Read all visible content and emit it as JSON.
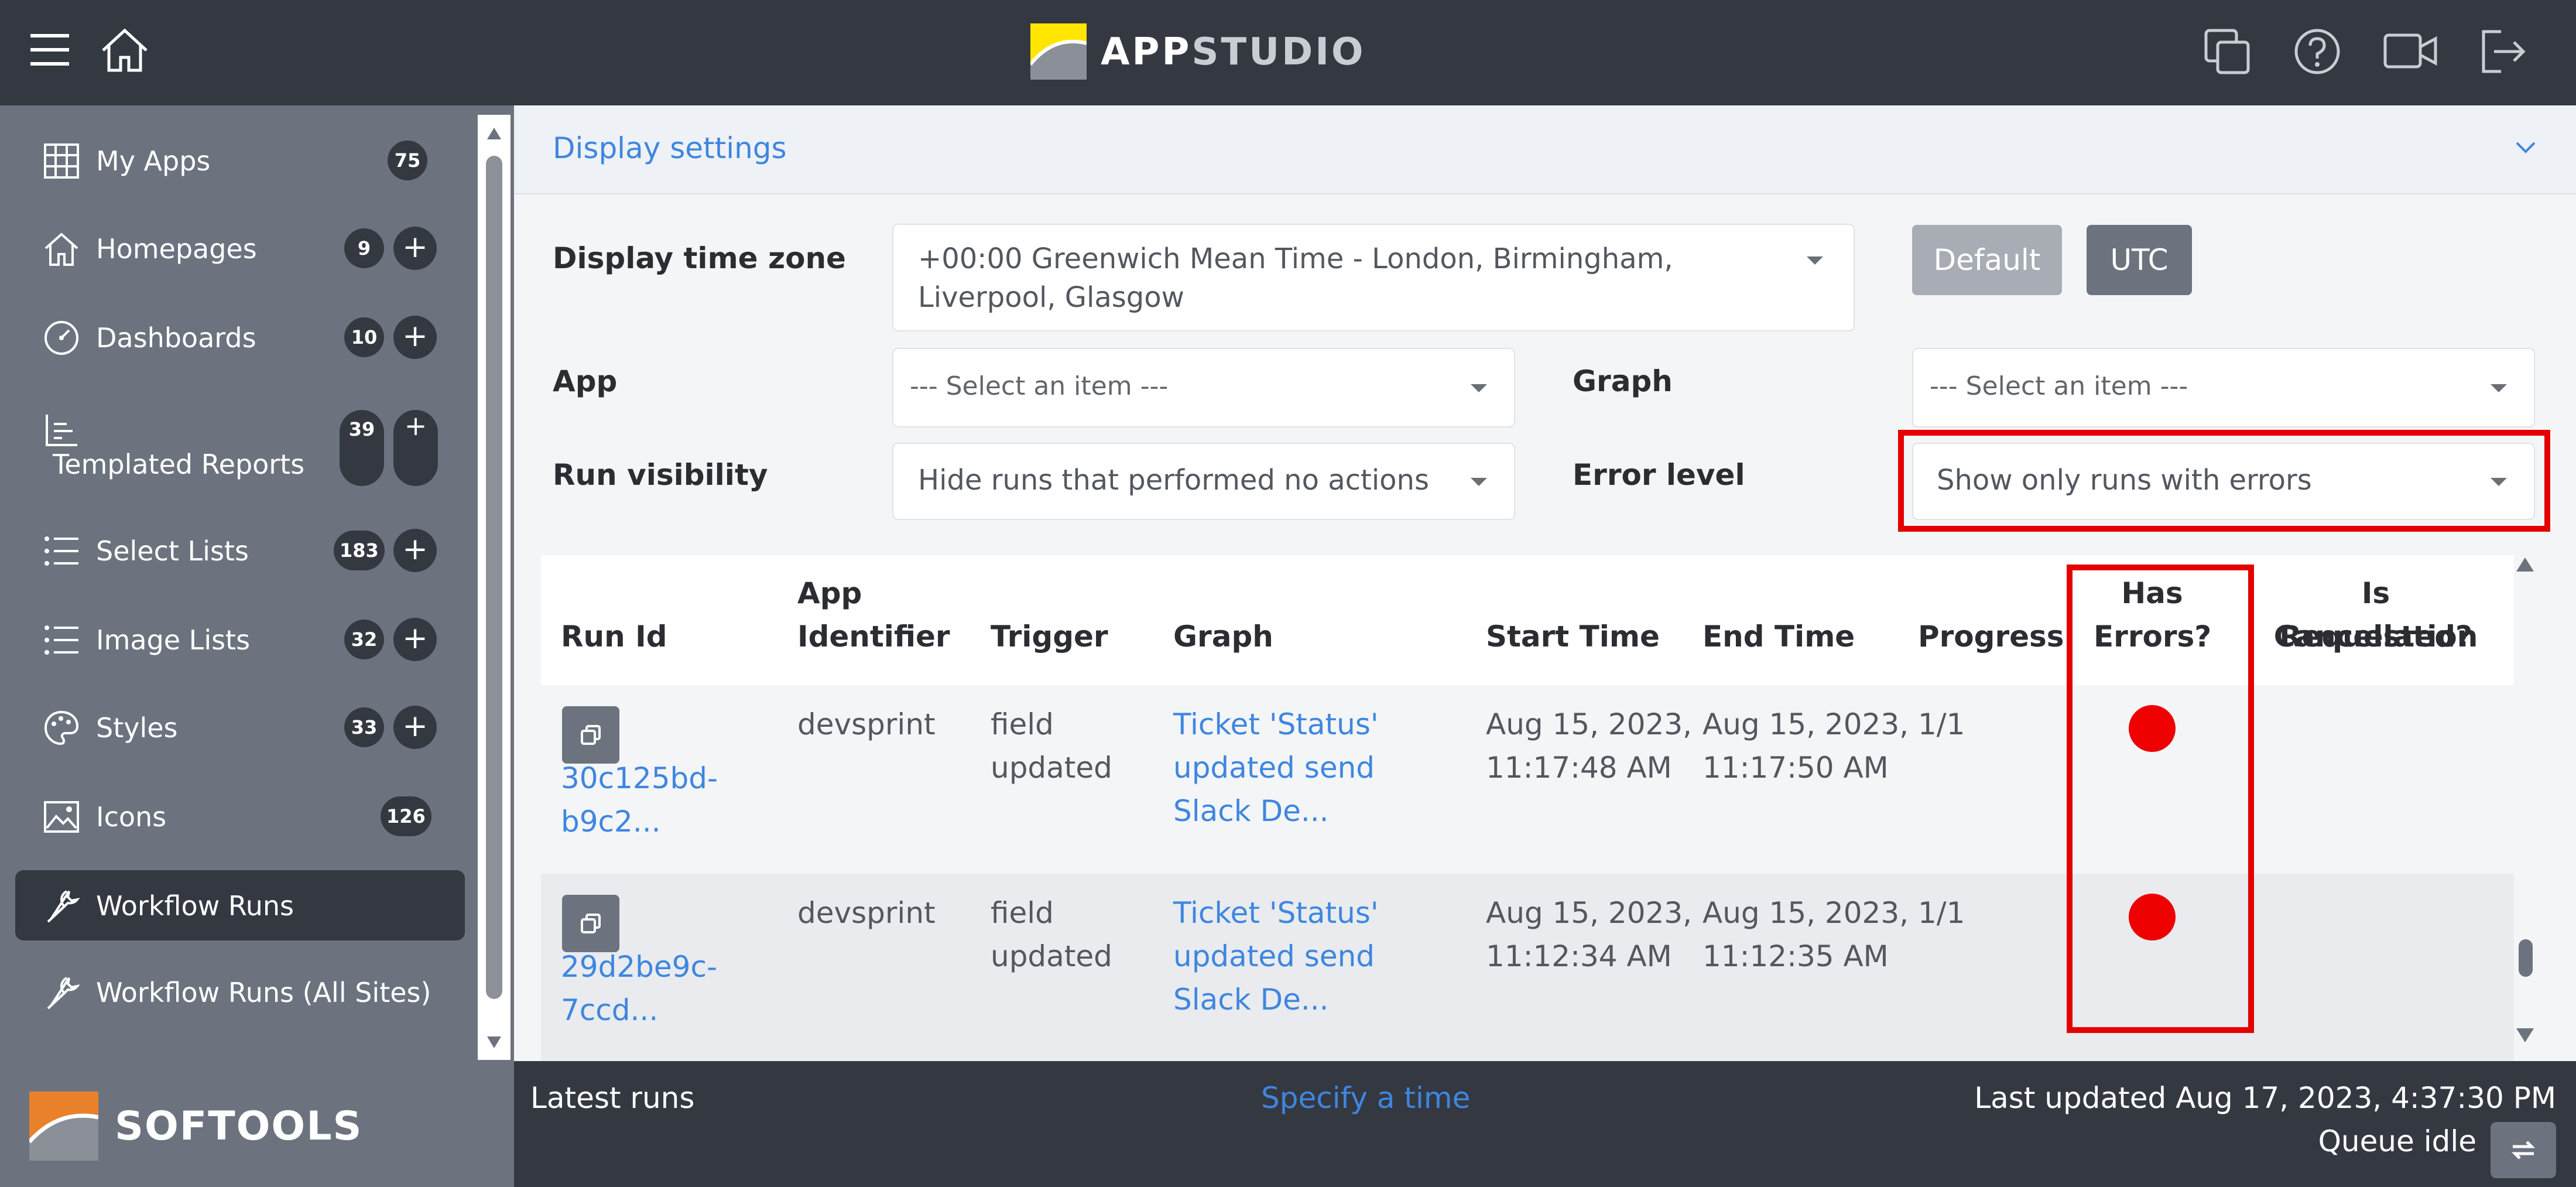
{
  "topbar": {
    "brand": {
      "part1": "APP",
      "part2": "STUDIO"
    },
    "icons": [
      "menu-icon",
      "home-icon",
      "copy-window-icon",
      "help-icon",
      "video-icon",
      "logout-icon"
    ]
  },
  "sidebar": {
    "items": [
      {
        "label": "My Apps",
        "icon": "grid-icon",
        "count": "75",
        "has_add": false
      },
      {
        "label": "Homepages",
        "icon": "home-icon",
        "count": "9",
        "has_add": true
      },
      {
        "label": "Dashboards",
        "icon": "gauge-icon",
        "count": "10",
        "has_add": true
      },
      {
        "label": "Templated Reports",
        "icon": "chart-icon",
        "count": "39",
        "has_add": true
      },
      {
        "label": "Select Lists",
        "icon": "list-icon",
        "count": "183",
        "has_add": true
      },
      {
        "label": "Image Lists",
        "icon": "list-icon",
        "count": "32",
        "has_add": true
      },
      {
        "label": "Styles",
        "icon": "palette-icon",
        "count": "33",
        "has_add": true
      },
      {
        "label": "Icons",
        "icon": "image-icon",
        "count": "126",
        "has_add": false
      },
      {
        "label": "Workflow Runs",
        "icon": "wrench-icon",
        "active": true
      },
      {
        "label": "Workflow Runs (All Sites)",
        "icon": "wrench-icon"
      }
    ],
    "plus_symbol": "+",
    "footer_brand": "SOFTOOLS"
  },
  "display_settings": {
    "title": "Display settings",
    "timezone_label": "Display time zone",
    "timezone_value_line1": "+00:00 Greenwich Mean Time - London, Birmingham,",
    "timezone_value_line2": "Liverpool, Glasgow",
    "default_button": "Default",
    "utc_button": "UTC",
    "app_label": "App",
    "app_placeholder": "--- Select an item ---",
    "graph_label": "Graph",
    "graph_placeholder": "--- Select an item ---",
    "run_visibility_label": "Run visibility",
    "run_visibility_value": "Hide runs that performed no actions",
    "error_level_label": "Error level",
    "error_level_value": "Show only runs with errors"
  },
  "table": {
    "headers": {
      "run_id": "Run Id",
      "app_identifier_1": "App",
      "app_identifier_2": "Identifier",
      "trigger": "Trigger",
      "graph": "Graph",
      "start_time": "Start Time",
      "end_time": "End Time",
      "progress": "Progress",
      "has_errors_1": "Has",
      "has_errors_2": "Errors?",
      "cancel_1": "Is Cancellation",
      "cancel_2": "Requested?"
    },
    "rows": [
      {
        "run_id_1": "30c125bd-",
        "run_id_2": "b9c2...",
        "app": "devsprint",
        "trigger_1": "field",
        "trigger_2": "updated",
        "graph_1": "Ticket 'Status'",
        "graph_2": "updated send",
        "graph_3": "Slack De...",
        "start_1": "Aug 15, 2023,",
        "start_2": "11:17:48 AM",
        "end_1": "Aug 15, 2023,",
        "end_2": "11:17:50 AM",
        "progress": "1/1",
        "has_errors": true,
        "error_color": "#ee0000"
      },
      {
        "run_id_1": "29d2be9c-",
        "run_id_2": "7ccd...",
        "app": "devsprint",
        "trigger_1": "field",
        "trigger_2": "updated",
        "graph_1": "Ticket 'Status'",
        "graph_2": "updated send",
        "graph_3": "Slack De...",
        "start_1": "Aug 15, 2023,",
        "start_2": "11:12:34 AM",
        "end_1": "Aug 15, 2023,",
        "end_2": "11:12:35 AM",
        "progress": "1/1",
        "has_errors": true,
        "error_color": "#ee0000"
      }
    ]
  },
  "bottom_bar": {
    "latest_runs": "Latest runs",
    "specify_time": "Specify a time",
    "last_updated": "Last updated Aug 17, 2023, 4:37:30 PM",
    "queue_status": "Queue idle"
  },
  "colors": {
    "header_bg": "#343841",
    "sidebar_bg": "#6c737f",
    "accent_link": "#3e86e0",
    "highlight": "#e50000",
    "brand_yellow": "#ffe600",
    "brand_orange": "#e8812a"
  }
}
